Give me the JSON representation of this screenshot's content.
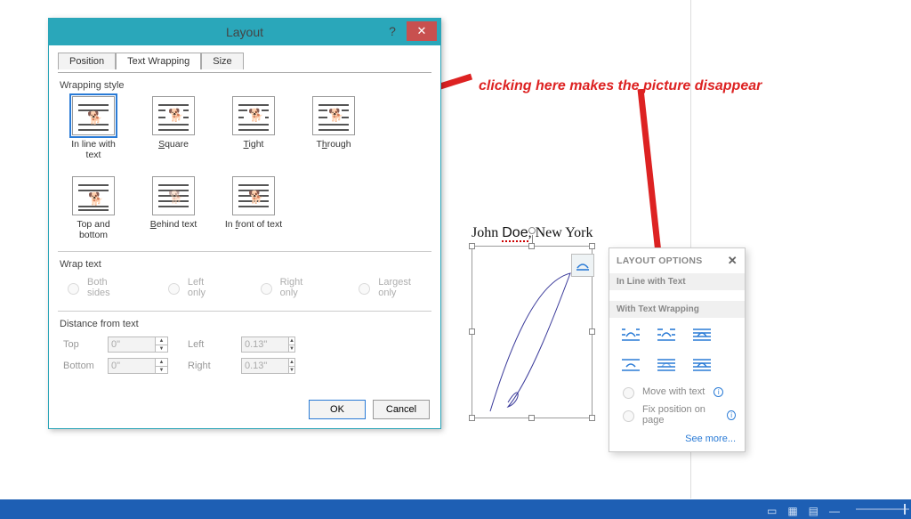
{
  "dialog": {
    "title": "Layout",
    "tabs": {
      "position": "Position",
      "wrapping": "Text Wrapping",
      "size": "Size"
    },
    "wrapStyleLabel": "Wrapping style",
    "wrapOptions": {
      "inline": "In line with text",
      "square": "Square",
      "tight": "Tight",
      "through": "Through",
      "topbottom": "Top and bottom",
      "behind": "Behind text",
      "infront": "In front of text"
    },
    "wrapTextLabel": "Wrap text",
    "wrapTextOptions": {
      "both": "Both sides",
      "left": "Left only",
      "right": "Right only",
      "largest": "Largest only"
    },
    "distanceLabel": "Distance from text",
    "dist": {
      "topLabel": "Top",
      "top": "0\"",
      "bottomLabel": "Bottom",
      "bottom": "0\"",
      "leftLabel": "Left",
      "left": "0.13\"",
      "rightLabel": "Right",
      "right": "0.13\""
    },
    "ok": "OK",
    "cancel": "Cancel"
  },
  "doc": {
    "name": "John Doe, New York"
  },
  "flyout": {
    "title": "LAYOUT OPTIONS",
    "sec1": "In Line with Text",
    "sec2": "With Text Wrapping",
    "moveWith": "Move with text",
    "fixPos": "Fix position on page",
    "seeMore": "See more..."
  },
  "annotation": "clicking here makes the picture disappear"
}
